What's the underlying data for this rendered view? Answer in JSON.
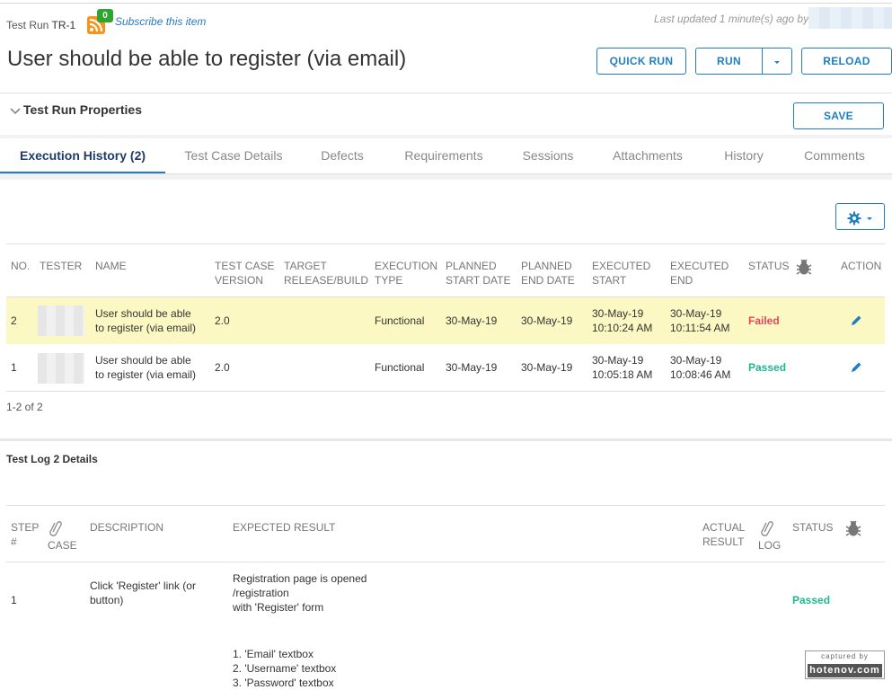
{
  "header": {
    "breadcrumb_prefix": "Test Run",
    "breadcrumb_id": "TR-1",
    "subscribe_count": "0",
    "subscribe_label": "Subscribe this item",
    "last_updated": "Last updated 1 minute(s) ago by",
    "title": "User should be able to register (via email)"
  },
  "toolbar": {
    "quick_run": "QUICK RUN",
    "run": "RUN",
    "reload": "RELOAD",
    "save": "SAVE"
  },
  "properties": {
    "label": "Test Run Properties"
  },
  "tabs": [
    {
      "label": "Execution History (2)"
    },
    {
      "label": "Test Case Details"
    },
    {
      "label": "Defects"
    },
    {
      "label": "Requirements"
    },
    {
      "label": "Sessions"
    },
    {
      "label": "Attachments"
    },
    {
      "label": "History"
    },
    {
      "label": "Comments"
    }
  ],
  "history": {
    "columns": {
      "no": "NO.",
      "tester": "TESTER",
      "name": "NAME",
      "tcv_1": "TEST CASE",
      "tcv_2": "VERSION",
      "target_1": "TARGET",
      "target_2": "RELEASE/BUILD",
      "exec_type_1": "EXECUTION",
      "exec_type_2": "TYPE",
      "pstart_1": "PLANNED",
      "pstart_2": "START DATE",
      "pend_1": "PLANNED",
      "pend_2": "END DATE",
      "estart_1": "EXECUTED",
      "estart_2": "START",
      "eend_1": "EXECUTED",
      "eend_2": "END",
      "status": "STATUS",
      "action": "ACTION"
    },
    "rows": [
      {
        "no": "2",
        "name_1": "User should be able",
        "name_2": "to register (via email)",
        "version": "2.0",
        "type": "Functional",
        "planned_start": "30-May-19",
        "planned_end": "30-May-19",
        "exec_start_1": "30-May-19",
        "exec_start_2": "10:10:24 AM",
        "exec_end_1": "30-May-19",
        "exec_end_2": "10:11:54 AM",
        "status": "Failed"
      },
      {
        "no": "1",
        "name_1": "User should be able",
        "name_2": "to register (via email)",
        "version": "2.0",
        "type": "Functional",
        "planned_start": "30-May-19",
        "planned_end": "30-May-19",
        "exec_start_1": "30-May-19",
        "exec_start_2": "10:05:18 AM",
        "exec_end_1": "30-May-19",
        "exec_end_2": "10:08:46 AM",
        "status": "Passed"
      }
    ],
    "pager": "1-2 of 2"
  },
  "log": {
    "title": "Test Log 2 Details",
    "columns": {
      "step_1": "STEP",
      "step_2": "#",
      "case": "CASE",
      "description": "DESCRIPTION",
      "expected": "EXPECTED RESULT",
      "actual_1": "ACTUAL",
      "actual_2": "RESULT",
      "log": "LOG",
      "status": "STATUS"
    },
    "rows": [
      {
        "step": "1",
        "desc_1": "Click 'Register' link (or",
        "desc_2": "button)",
        "exp_1": "Registration page is opened",
        "exp_2": "/registration",
        "exp_3": "with 'Register' form",
        "exp_4": "1. 'Email' textbox",
        "exp_5": "2. 'Username' textbox",
        "exp_6": "3. 'Password' textbox",
        "status": "Passed"
      }
    ]
  },
  "watermark": {
    "top": "captured by",
    "bottom": "hotenov.com"
  },
  "colors": {
    "accent": "#1f7fbf",
    "failed": "#e8455a",
    "passed": "#1db88d",
    "highlight": "#fcf8c3"
  }
}
